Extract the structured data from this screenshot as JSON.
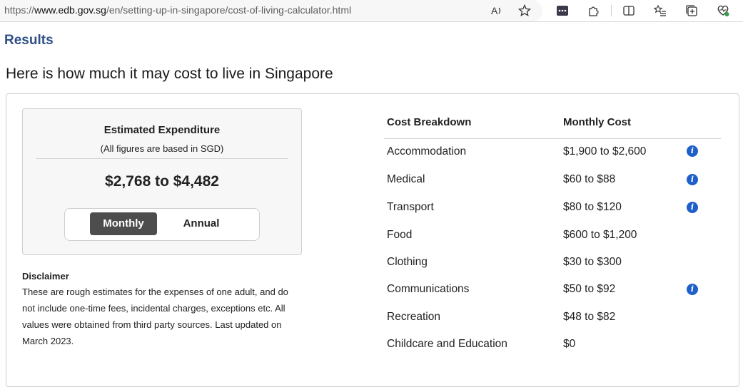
{
  "browser": {
    "url_prefix": "https://",
    "url_host": "www.edb.gov.sg",
    "url_path": "/en/setting-up-in-singapore/cost-of-living-calculator.html"
  },
  "page": {
    "results_label": "Results",
    "title": "Here is how much it may cost to live in Singapore"
  },
  "estimate": {
    "title": "Estimated Expenditure",
    "subtitle": "(All figures are based in SGD)",
    "amount": "$2,768 to $4,482",
    "toggle": {
      "monthly_label": "Monthly",
      "annual_label": "Annual",
      "selected": "Monthly"
    }
  },
  "disclaimer": {
    "heading": "Disclaimer",
    "body": "These are rough estimates for the expenses of one adult, and do not include one-time fees, incidental charges, exceptions etc. All values were obtained from third party sources. Last updated on March 2023."
  },
  "breakdown": {
    "headers": [
      "Cost Breakdown",
      "Monthly Cost"
    ],
    "rows": [
      {
        "category": "Accommodation",
        "cost": "$1,900 to $2,600",
        "info": true
      },
      {
        "category": "Medical",
        "cost": "$60 to $88",
        "info": true
      },
      {
        "category": "Transport",
        "cost": "$80 to $120",
        "info": true
      },
      {
        "category": "Food",
        "cost": "$600 to $1,200",
        "info": false
      },
      {
        "category": "Clothing",
        "cost": "$30 to $300",
        "info": false
      },
      {
        "category": "Communications",
        "cost": "$50 to $92",
        "info": true
      },
      {
        "category": "Recreation",
        "cost": "$48 to $82",
        "info": false
      },
      {
        "category": "Childcare and Education",
        "cost": "$0",
        "info": false
      }
    ]
  },
  "colors": {
    "accent_link": "#2f4f86",
    "info_icon": "#1f5fc9",
    "toggle_active": "#4d4d4d"
  },
  "icons": [
    "read-aloud-icon",
    "favorite-star-icon",
    "extension-icon",
    "puzzle-icon",
    "split-screen-icon",
    "favorites-list-icon",
    "collections-icon",
    "browser-essentials-icon",
    "info-icon"
  ]
}
